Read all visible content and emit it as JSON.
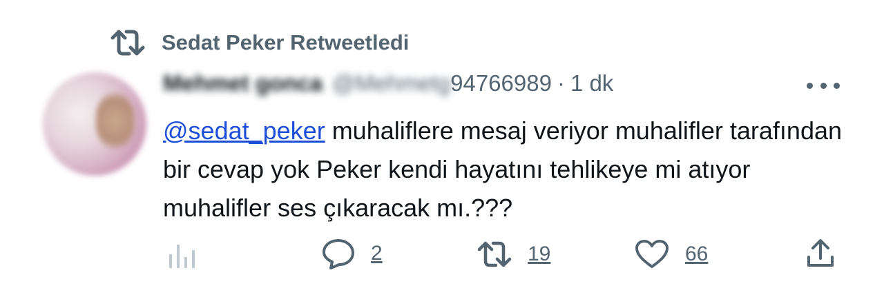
{
  "retweet_context": {
    "icon": "retweet-icon",
    "text": "Sedat Peker Retweetledi"
  },
  "tweet": {
    "author_name": "Mehmet gonca",
    "handle_prefix": "@Mehmetg",
    "handle_suffix": "94766989",
    "separator": "·",
    "time": "1 dk",
    "mention": "@sedat_peker",
    "text": " muhaliflere mesaj veriyor muhalifler tarafından bir cevap yok Peker kendi hayatını tehlikeye mi atıyor muhalifler ses çıkaracak mı.???"
  },
  "actions": {
    "views": {
      "icon": "analytics-icon"
    },
    "replies": {
      "icon": "reply-icon",
      "count": "2"
    },
    "retweets": {
      "icon": "retweet-icon",
      "count": "19"
    },
    "likes": {
      "icon": "heart-icon",
      "count": "66"
    },
    "share": {
      "icon": "share-icon"
    }
  },
  "colors": {
    "secondary": "#536471",
    "text": "#0f1419",
    "link": "#1d4ed8"
  }
}
